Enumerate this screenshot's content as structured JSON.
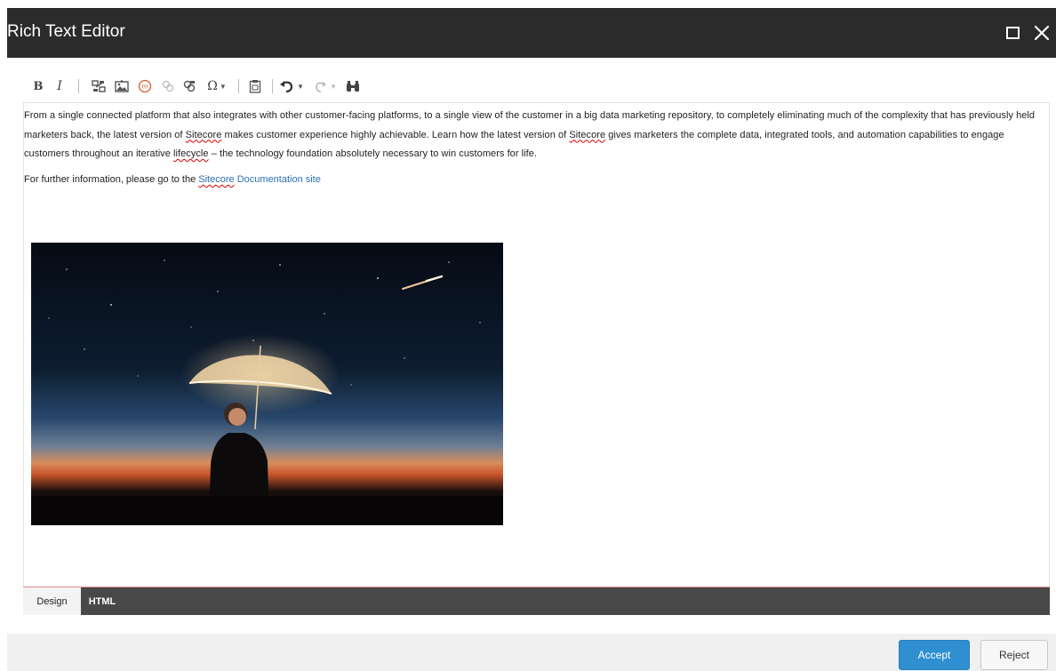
{
  "window": {
    "title": "Rich Text Editor",
    "maximize_icon": "maximize-icon",
    "close_icon": "close-icon"
  },
  "toolbar": {
    "bold_label": "B",
    "italic_label": "I",
    "symbol_label": "Ω",
    "icons": [
      "bold-icon",
      "italic-icon",
      "insert-link-icon",
      "insert-image-icon",
      "insert-media-icon",
      "remove-link-icon",
      "sitecore-link-icon",
      "symbol-icon",
      "paste-icon",
      "undo-icon",
      "redo-icon",
      "find-replace-icon"
    ]
  },
  "content": {
    "para1_a": "From a single connected platform that also integrates with other customer-facing platforms, to a single view of the customer in a big data marketing repository, to completely eliminating much of the complexity that has previously held marketers back, the latest version of ",
    "sitecore_1": "Sitecore",
    "para1_b": " makes customer experience highly achievable. Learn how the latest version of ",
    "sitecore_2": "Sitecore",
    "para1_c": " gives marketers the complete data, integrated tools, and automation capabilities to engage customers throughout an iterative ",
    "lifecycle": "lifecycle",
    "para1_d": " – the technology foundation absolutely necessary to win customers for life.",
    "para2_prefix": "For further information, please go to the ",
    "link_sitecore": "Sitecore",
    "link_rest": " Documentation site",
    "image": "night-sky-person-with-lit-umbrella"
  },
  "tabs": {
    "design": "Design",
    "html": "HTML"
  },
  "footer": {
    "accept": "Accept",
    "reject": "Reject"
  },
  "colors": {
    "titlebar": "#2b2b2b",
    "accent": "#2f8fd0",
    "link": "#2a70b8",
    "tabbar": "#484848"
  }
}
